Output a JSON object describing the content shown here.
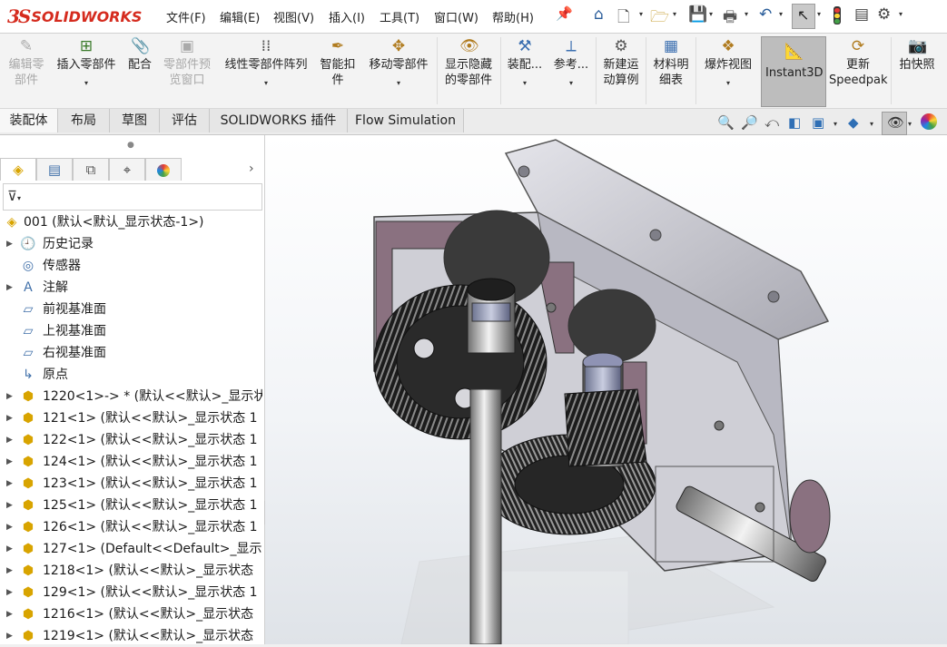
{
  "app": {
    "brand_ds": "3S",
    "brand_name": "SOLIDWORKS"
  },
  "menu": [
    "文件(F)",
    "编辑(E)",
    "视图(V)",
    "插入(I)",
    "工具(T)",
    "窗口(W)",
    "帮助(H)"
  ],
  "quick_access_icons": [
    "home-icon",
    "new-file-icon",
    "open-file-icon",
    "save-icon",
    "print-icon",
    "undo-icon",
    "select-arrow-icon",
    "rebuild-traffic-light-icon",
    "file-properties-icon",
    "options-gear-icon"
  ],
  "command_manager": {
    "edit_component": "编辑零\n部件",
    "insert_component": "插入零部件",
    "mate": "配合",
    "component_preview": "零部件预\n览窗口",
    "linear_pattern": "线性零部件阵列",
    "smart_fasteners": "智能扣\n件",
    "move_component": "移动零部件",
    "show_hidden": "显示隐藏\n的零部件",
    "assembly_features": "装配...",
    "reference_geometry": "参考...",
    "new_motion_study": "新建运\n动算例",
    "bom": "材料明\n细表",
    "exploded_view": "爆炸视图",
    "instant3d": "Instant3D",
    "update_speedpak": "更新\nSpeedpak",
    "take_snapshot": "拍快照"
  },
  "tabs": [
    "装配体",
    "布局",
    "草图",
    "评估",
    "SOLIDWORKS 插件",
    "Flow Simulation"
  ],
  "active_tab": 0,
  "feature_tree": {
    "root": "001  (默认<默认_显示状态-1>)",
    "items": [
      {
        "label": "历史记录",
        "icon": "history-icon",
        "expand": true
      },
      {
        "label": "传感器",
        "icon": "sensor-icon",
        "expand": false
      },
      {
        "label": "注解",
        "icon": "annotation-icon",
        "expand": true
      },
      {
        "label": "前视基准面",
        "icon": "plane-icon",
        "expand": false
      },
      {
        "label": "上视基准面",
        "icon": "plane-icon",
        "expand": false
      },
      {
        "label": "右视基准面",
        "icon": "plane-icon",
        "expand": false
      },
      {
        "label": "原点",
        "icon": "origin-icon",
        "expand": false
      },
      {
        "label": "1220<1>-> * (默认<<默认>_显示状",
        "icon": "part-icon",
        "expand": true
      },
      {
        "label": "121<1> (默认<<默认>_显示状态 1",
        "icon": "part-icon",
        "expand": true
      },
      {
        "label": "122<1> (默认<<默认>_显示状态 1",
        "icon": "part-icon",
        "expand": true
      },
      {
        "label": "124<1> (默认<<默认>_显示状态 1",
        "icon": "part-icon",
        "expand": true
      },
      {
        "label": "123<1> (默认<<默认>_显示状态 1",
        "icon": "part-icon",
        "expand": true
      },
      {
        "label": "125<1> (默认<<默认>_显示状态 1",
        "icon": "part-icon",
        "expand": true
      },
      {
        "label": "126<1> (默认<<默认>_显示状态 1",
        "icon": "part-icon",
        "expand": true
      },
      {
        "label": "127<1> (Default<<Default>_显示",
        "icon": "part-icon",
        "expand": true
      },
      {
        "label": "1218<1> (默认<<默认>_显示状态",
        "icon": "part-icon",
        "expand": true
      },
      {
        "label": "129<1> (默认<<默认>_显示状态 1",
        "icon": "part-icon",
        "expand": true
      },
      {
        "label": "1216<1> (默认<<默认>_显示状态",
        "icon": "part-icon",
        "expand": true
      },
      {
        "label": "1219<1> (默认<<默认>_显示状态",
        "icon": "part-icon",
        "expand": true
      }
    ]
  },
  "colors": {
    "brand_red": "#d52b1e",
    "part_yellow": "#e3ad00",
    "housing": "#cfcfd6",
    "section_cut": "#8a7180"
  }
}
